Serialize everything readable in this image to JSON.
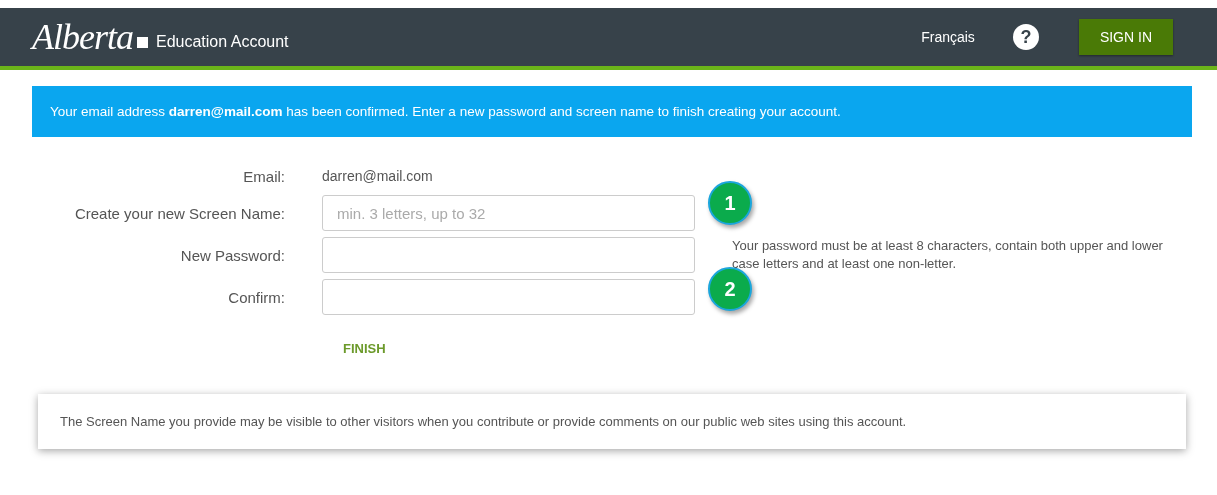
{
  "header": {
    "logo": "Alberta",
    "title": "Education Account",
    "language_link": "Français",
    "help": "?",
    "sign_in": "SIGN IN"
  },
  "banner": "Your email address **darren@mail.com** has been confirmed. Enter a new password and screen name to finish creating your account.",
  "form": {
    "rows": [
      {
        "kind": "static",
        "label": "Email:",
        "value": "darren@mail.com"
      },
      {
        "kind": "input",
        "label": "Create your new Screen Name:",
        "placeholder": "min. 3 letters, up to 32"
      },
      {
        "kind": "input",
        "label": "New Password:"
      },
      {
        "kind": "input",
        "label": "Confirm:"
      }
    ],
    "hint": "Your password must be at least 8 characters, contain both upper and lower case letters and at least one non-letter.",
    "callouts": [
      "1",
      "2"
    ],
    "finish": "FINISH"
  },
  "note": "The Screen Name you provide may be visible to other visitors when you contribute or provide comments on our public web sites using this account."
}
